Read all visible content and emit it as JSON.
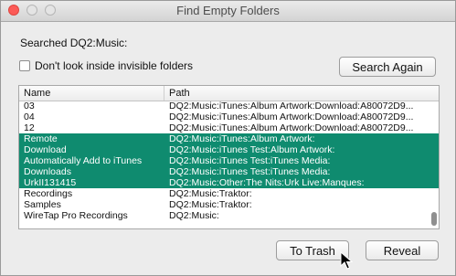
{
  "window": {
    "title": "Find Empty Folders"
  },
  "searched_text": "Searched DQ2:Music:",
  "options": {
    "invisible_label": "Don't look inside invisible folders",
    "invisible_checked": false
  },
  "buttons": {
    "search_again": "Search Again",
    "to_trash": "To Trash",
    "reveal": "Reveal"
  },
  "table": {
    "columns": [
      "Name",
      "Path"
    ],
    "rows": [
      {
        "name": "03",
        "path": "DQ2:Music:iTunes:Album Artwork:Download:A80072D9...",
        "selected": false
      },
      {
        "name": "04",
        "path": "DQ2:Music:iTunes:Album Artwork:Download:A80072D9...",
        "selected": false
      },
      {
        "name": "12",
        "path": "DQ2:Music:iTunes:Album Artwork:Download:A80072D9...",
        "selected": false
      },
      {
        "name": "Remote",
        "path": "DQ2:Music:iTunes:Album Artwork:",
        "selected": true
      },
      {
        "name": "Download",
        "path": "DQ2:Music:iTunes Test:Album Artwork:",
        "selected": true
      },
      {
        "name": "Automatically Add to iTunes",
        "path": "DQ2:Music:iTunes Test:iTunes Media:",
        "selected": true
      },
      {
        "name": "Downloads",
        "path": "DQ2:Music:iTunes Test:iTunes Media:",
        "selected": true
      },
      {
        "name": "UrkII131415",
        "path": "DQ2:Music:Other:The Nits:Urk Live:Manques:",
        "selected": true
      },
      {
        "name": "Recordings",
        "path": "DQ2:Music:Traktor:",
        "selected": false
      },
      {
        "name": "Samples",
        "path": "DQ2:Music:Traktor:",
        "selected": false
      },
      {
        "name": "WireTap Pro Recordings",
        "path": "DQ2:Music:",
        "selected": false
      }
    ]
  },
  "colors": {
    "selection": "#0f8b6f",
    "close_button": "#fc5b57"
  }
}
